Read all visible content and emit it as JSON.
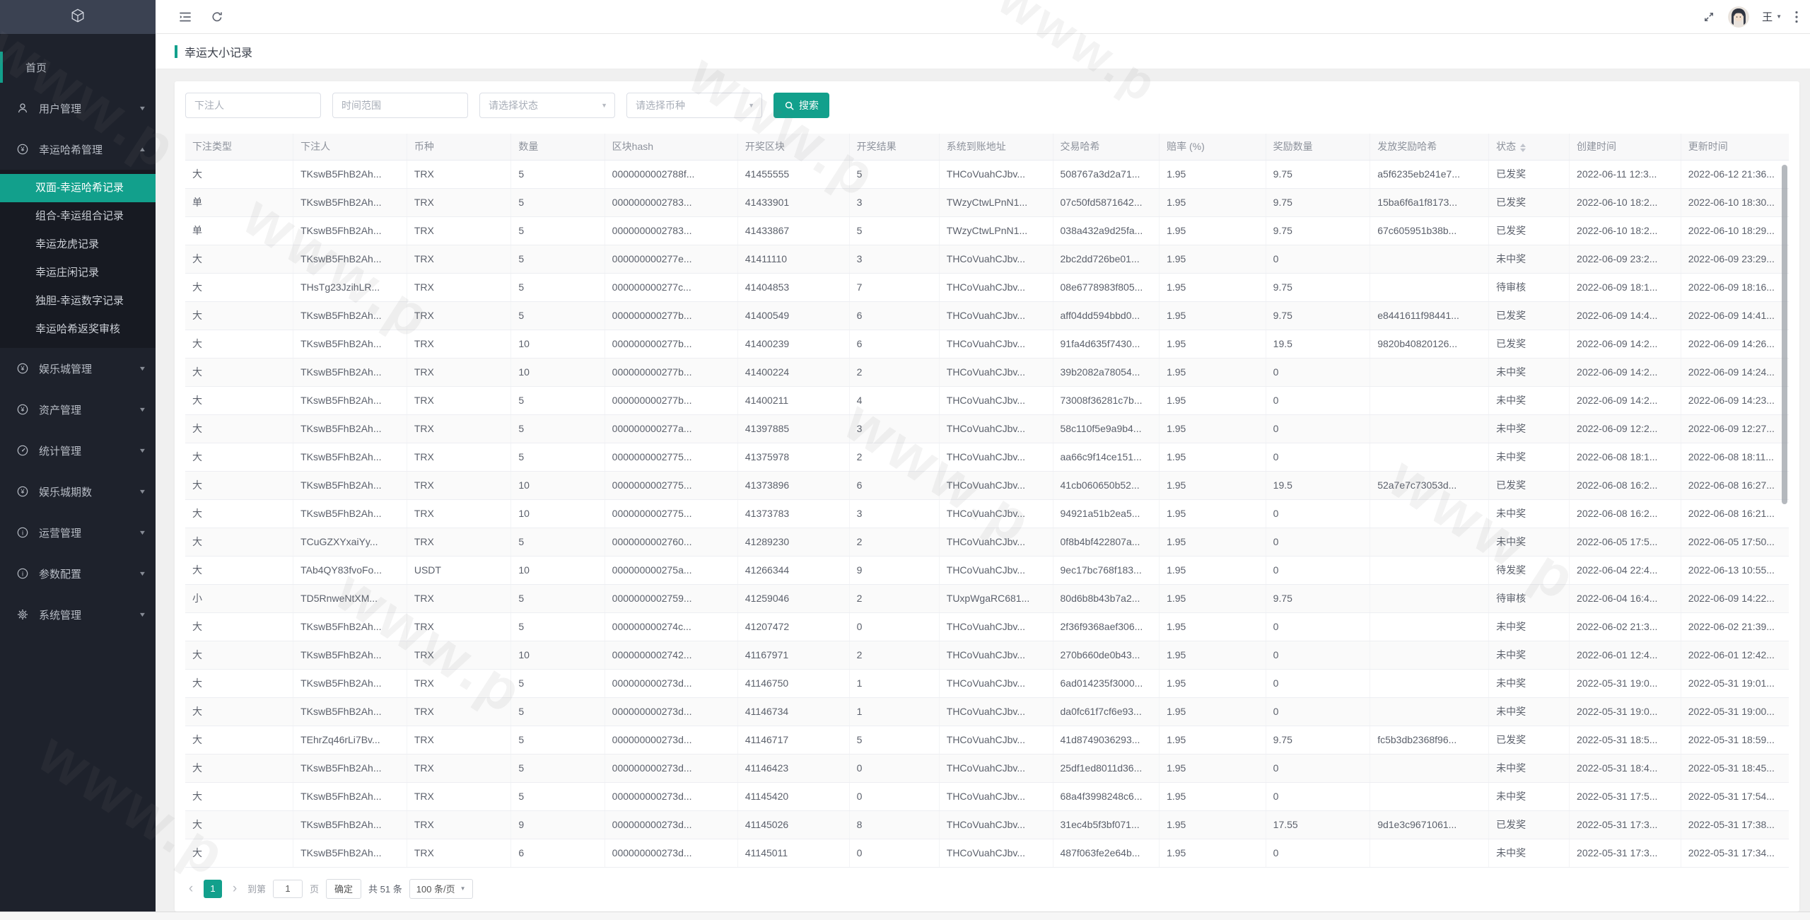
{
  "watermark": {
    "text": "www.p"
  },
  "colors": {
    "accent": "#12a08c",
    "sidebar_bg": "#1e222c",
    "logo_bg": "#3b4252",
    "submenu_bg": "#171a22"
  },
  "topbar": {
    "user_name": "王"
  },
  "sidebar": {
    "items": [
      {
        "label": "首页",
        "accent_bar": true
      },
      {
        "label": "用户管理",
        "icon": "user-icon",
        "caret": "down"
      },
      {
        "label": "幸运哈希管理",
        "icon": "yen-circle-icon",
        "caret": "up",
        "children": [
          {
            "label": "双面-幸运哈希记录",
            "active": true
          },
          {
            "label": "组合-幸运组合记录"
          },
          {
            "label": "幸运龙虎记录"
          },
          {
            "label": "幸运庄闲记录"
          },
          {
            "label": "独胆-幸运数字记录"
          },
          {
            "label": "幸运哈希返奖审核"
          }
        ]
      },
      {
        "label": "娱乐城管理",
        "icon": "yen-circle-icon",
        "caret": "down"
      },
      {
        "label": "资产管理",
        "icon": "yen-circle-icon",
        "caret": "down"
      },
      {
        "label": "统计管理",
        "icon": "gauge-icon",
        "caret": "down"
      },
      {
        "label": "娱乐城期数",
        "icon": "yen-circle-icon",
        "caret": "down"
      },
      {
        "label": "运营管理",
        "icon": "info-icon",
        "caret": "down"
      },
      {
        "label": "参数配置",
        "icon": "info-icon",
        "caret": "down"
      },
      {
        "label": "系统管理",
        "icon": "gear-icon",
        "caret": "down"
      }
    ]
  },
  "page": {
    "title": "幸运大小记录"
  },
  "filters": {
    "bettor_placeholder": "下注人",
    "time_range_placeholder": "时间范围",
    "status_placeholder": "请选择状态",
    "coin_placeholder": "请选择币种",
    "search_label": "搜索"
  },
  "table": {
    "columns": [
      {
        "label": "下注类型"
      },
      {
        "label": "下注人"
      },
      {
        "label": "币种"
      },
      {
        "label": "数量"
      },
      {
        "label": "区块hash"
      },
      {
        "label": "开奖区块"
      },
      {
        "label": "开奖结果"
      },
      {
        "label": "系统到账地址"
      },
      {
        "label": "交易哈希"
      },
      {
        "label": "赔率 (%)"
      },
      {
        "label": "奖励数量"
      },
      {
        "label": "发放奖励哈希"
      },
      {
        "label": "状态",
        "sortable": true
      },
      {
        "label": "创建时间"
      },
      {
        "label": "更新时间"
      }
    ],
    "rows": [
      [
        "大",
        "TKswB5FhB2Ah...",
        "TRX",
        "5",
        "0000000002788f...",
        "41455555",
        "5",
        "THCoVuahCJbv...",
        "508767a3d2a71...",
        "1.95",
        "9.75",
        "a5f6235eb241e7...",
        "已发奖",
        "2022-06-11 12:3...",
        "2022-06-12 21:36..."
      ],
      [
        "单",
        "TKswB5FhB2Ah...",
        "TRX",
        "5",
        "0000000002783...",
        "41433901",
        "3",
        "TWzyCtwLPnN1...",
        "07c50fd5871642...",
        "1.95",
        "9.75",
        "15ba6f6a1f8173...",
        "已发奖",
        "2022-06-10 18:2...",
        "2022-06-10 18:30..."
      ],
      [
        "单",
        "TKswB5FhB2Ah...",
        "TRX",
        "5",
        "0000000002783...",
        "41433867",
        "5",
        "TWzyCtwLPnN1...",
        "038a432a9d25fa...",
        "1.95",
        "9.75",
        "67c605951b38b...",
        "已发奖",
        "2022-06-10 18:2...",
        "2022-06-10 18:29..."
      ],
      [
        "大",
        "TKswB5FhB2Ah...",
        "TRX",
        "5",
        "000000000277e...",
        "41411110",
        "3",
        "THCoVuahCJbv...",
        "2bc2dd726be01...",
        "1.95",
        "0",
        "",
        "未中奖",
        "2022-06-09 23:2...",
        "2022-06-09 23:29..."
      ],
      [
        "大",
        "THsTg23JzihLR...",
        "TRX",
        "5",
        "000000000277c...",
        "41404853",
        "7",
        "THCoVuahCJbv...",
        "08e6778983f805...",
        "1.95",
        "9.75",
        "",
        "待审核",
        "2022-06-09 18:1...",
        "2022-06-09 18:16..."
      ],
      [
        "大",
        "TKswB5FhB2Ah...",
        "TRX",
        "5",
        "000000000277b...",
        "41400549",
        "6",
        "THCoVuahCJbv...",
        "aff04dd594bbd0...",
        "1.95",
        "9.75",
        "e8441611f98441...",
        "已发奖",
        "2022-06-09 14:4...",
        "2022-06-09 14:41..."
      ],
      [
        "大",
        "TKswB5FhB2Ah...",
        "TRX",
        "10",
        "000000000277b...",
        "41400239",
        "6",
        "THCoVuahCJbv...",
        "91fa4d635f7430...",
        "1.95",
        "19.5",
        "9820b40820126...",
        "已发奖",
        "2022-06-09 14:2...",
        "2022-06-09 14:26..."
      ],
      [
        "大",
        "TKswB5FhB2Ah...",
        "TRX",
        "10",
        "000000000277b...",
        "41400224",
        "2",
        "THCoVuahCJbv...",
        "39b2082a78054...",
        "1.95",
        "0",
        "",
        "未中奖",
        "2022-06-09 14:2...",
        "2022-06-09 14:24..."
      ],
      [
        "大",
        "TKswB5FhB2Ah...",
        "TRX",
        "5",
        "000000000277b...",
        "41400211",
        "4",
        "THCoVuahCJbv...",
        "73008f36281c7b...",
        "1.95",
        "0",
        "",
        "未中奖",
        "2022-06-09 14:2...",
        "2022-06-09 14:23..."
      ],
      [
        "大",
        "TKswB5FhB2Ah...",
        "TRX",
        "5",
        "000000000277a...",
        "41397885",
        "3",
        "THCoVuahCJbv...",
        "58c110f5e9a9b4...",
        "1.95",
        "0",
        "",
        "未中奖",
        "2022-06-09 12:2...",
        "2022-06-09 12:27..."
      ],
      [
        "大",
        "TKswB5FhB2Ah...",
        "TRX",
        "5",
        "0000000002775...",
        "41375978",
        "2",
        "THCoVuahCJbv...",
        "aa66c9f14ce151...",
        "1.95",
        "0",
        "",
        "未中奖",
        "2022-06-08 18:1...",
        "2022-06-08 18:11..."
      ],
      [
        "大",
        "TKswB5FhB2Ah...",
        "TRX",
        "10",
        "0000000002775...",
        "41373896",
        "6",
        "THCoVuahCJbv...",
        "41cb060650b52...",
        "1.95",
        "19.5",
        "52a7e7c73053d...",
        "已发奖",
        "2022-06-08 16:2...",
        "2022-06-08 16:27..."
      ],
      [
        "大",
        "TKswB5FhB2Ah...",
        "TRX",
        "10",
        "0000000002775...",
        "41373783",
        "3",
        "THCoVuahCJbv...",
        "94921a51b2ea5...",
        "1.95",
        "0",
        "",
        "未中奖",
        "2022-06-08 16:2...",
        "2022-06-08 16:21..."
      ],
      [
        "大",
        "TCuGZXYxaiYy...",
        "TRX",
        "5",
        "0000000002760...",
        "41289230",
        "2",
        "THCoVuahCJbv...",
        "0f8b4bf422807a...",
        "1.95",
        "0",
        "",
        "未中奖",
        "2022-06-05 17:5...",
        "2022-06-05 17:50..."
      ],
      [
        "大",
        "TAb4QY83fvoFo...",
        "USDT",
        "10",
        "000000000275a...",
        "41266344",
        "9",
        "THCoVuahCJbv...",
        "9ec17bc768f183...",
        "1.95",
        "0",
        "",
        "待发奖",
        "2022-06-04 22:4...",
        "2022-06-13 10:55..."
      ],
      [
        "小",
        "TD5RnweNtXM...",
        "TRX",
        "5",
        "0000000002759...",
        "41259046",
        "2",
        "TUxpWgaRC681...",
        "80d6b8b43b7a2...",
        "1.95",
        "9.75",
        "",
        "待审核",
        "2022-06-04 16:4...",
        "2022-06-09 14:22..."
      ],
      [
        "大",
        "TKswB5FhB2Ah...",
        "TRX",
        "5",
        "000000000274c...",
        "41207472",
        "0",
        "THCoVuahCJbv...",
        "2f36f9368aef306...",
        "1.95",
        "0",
        "",
        "未中奖",
        "2022-06-02 21:3...",
        "2022-06-02 21:39..."
      ],
      [
        "大",
        "TKswB5FhB2Ah...",
        "TRX",
        "10",
        "0000000002742...",
        "41167971",
        "2",
        "THCoVuahCJbv...",
        "270b660de0b43...",
        "1.95",
        "0",
        "",
        "未中奖",
        "2022-06-01 12:4...",
        "2022-06-01 12:42..."
      ],
      [
        "大",
        "TKswB5FhB2Ah...",
        "TRX",
        "5",
        "000000000273d...",
        "41146750",
        "1",
        "THCoVuahCJbv...",
        "6ad014235f3000...",
        "1.95",
        "0",
        "",
        "未中奖",
        "2022-05-31 19:0...",
        "2022-05-31 19:01..."
      ],
      [
        "大",
        "TKswB5FhB2Ah...",
        "TRX",
        "5",
        "000000000273d...",
        "41146734",
        "1",
        "THCoVuahCJbv...",
        "da0fc61f7cf6e93...",
        "1.95",
        "0",
        "",
        "未中奖",
        "2022-05-31 19:0...",
        "2022-05-31 19:00..."
      ],
      [
        "大",
        "TEhrZq46rLi7Bv...",
        "TRX",
        "5",
        "000000000273d...",
        "41146717",
        "5",
        "THCoVuahCJbv...",
        "41d8749036293...",
        "1.95",
        "9.75",
        "fc5b3db2368f96...",
        "已发奖",
        "2022-05-31 18:5...",
        "2022-05-31 18:59..."
      ],
      [
        "大",
        "TKswB5FhB2Ah...",
        "TRX",
        "5",
        "000000000273d...",
        "41146423",
        "0",
        "THCoVuahCJbv...",
        "25df1ed8011d36...",
        "1.95",
        "0",
        "",
        "未中奖",
        "2022-05-31 18:4...",
        "2022-05-31 18:45..."
      ],
      [
        "大",
        "TKswB5FhB2Ah...",
        "TRX",
        "5",
        "000000000273d...",
        "41145420",
        "0",
        "THCoVuahCJbv...",
        "68a4f3998248c6...",
        "1.95",
        "0",
        "",
        "未中奖",
        "2022-05-31 17:5...",
        "2022-05-31 17:54..."
      ],
      [
        "大",
        "TKswB5FhB2Ah...",
        "TRX",
        "9",
        "000000000273d...",
        "41145026",
        "8",
        "THCoVuahCJbv...",
        "31ec4b5f3bf071...",
        "1.95",
        "17.55",
        "9d1e3c9671061...",
        "已发奖",
        "2022-05-31 17:3...",
        "2022-05-31 17:38..."
      ],
      [
        "大",
        "TKswB5FhB2Ah...",
        "TRX",
        "6",
        "000000000273d...",
        "41145011",
        "0",
        "THCoVuahCJbv...",
        "487f063fe2e64b...",
        "1.95",
        "0",
        "",
        "未中奖",
        "2022-05-31 17:3...",
        "2022-05-31 17:34..."
      ]
    ]
  },
  "pagination": {
    "prev": "‹",
    "page": "1",
    "next": "›",
    "goto_label": "到第",
    "goto_value": "1",
    "page_unit_label": "页",
    "confirm_label": "确定",
    "total_label": "共 51 条",
    "page_size": "100 条/页"
  }
}
